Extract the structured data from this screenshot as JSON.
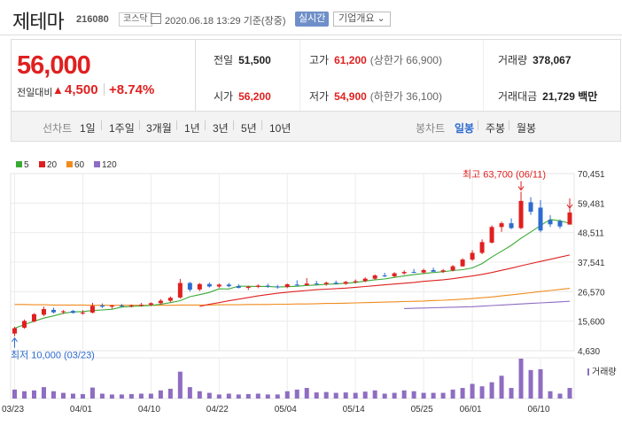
{
  "header": {
    "name": "제테마",
    "code": "216080",
    "market": "코스닥",
    "timestamp": "2020.06.18 13:29 기준(장중)",
    "realtime": "실시간",
    "company_info": "기업개요 ⌄"
  },
  "price": {
    "current": "56,000",
    "change_label": "전일대비",
    "change_arrow": "▲",
    "change_value": "4,500",
    "change_rate": "+8.74%"
  },
  "stats": {
    "prev_close_label": "전일",
    "prev_close": "51,500",
    "high_label": "고가",
    "high": "61,200",
    "upper_limit": "(상한가 66,900)",
    "volume_label": "거래량",
    "volume": "378,067",
    "open_label": "시가",
    "open": "56,200",
    "low_label": "저가",
    "low": "54,900",
    "lower_limit": "(하한가 36,100)",
    "trade_value_label": "거래대금",
    "trade_value": "21,729 백만"
  },
  "periods": {
    "line_label": "선차트",
    "line_items": [
      "1일",
      "1주일",
      "3개월",
      "1년",
      "3년",
      "5년",
      "10년"
    ],
    "candle_label": "봉차트",
    "candle_items": [
      "일봉",
      "주봉",
      "월봉"
    ],
    "active_candle": "일봉"
  },
  "colors": {
    "up": "#e02020",
    "down": "#2d6bd0",
    "ma5": "#3aaa35",
    "ma20": "#e02020",
    "ma60": "#f08c1e",
    "ma120": "#8e6dc2",
    "volume": "#8e6dc2"
  },
  "chart_data": {
    "type": "candlestick",
    "legend": [
      {
        "name": "5",
        "color": "#3aaa35"
      },
      {
        "name": "20",
        "color": "#e02020"
      },
      {
        "name": "60",
        "color": "#f08c1e"
      },
      {
        "name": "120",
        "color": "#8e6dc2"
      }
    ],
    "y_ticks": [
      "70,451",
      "59,481",
      "48,511",
      "37,541",
      "26,570",
      "15,600",
      "4,630"
    ],
    "ylim": [
      4630,
      70451
    ],
    "x_ticks": [
      "03/23",
      "04/01",
      "04/10",
      "04/22",
      "05/04",
      "05/14",
      "05/25",
      "06/01",
      "06/10"
    ],
    "x_tick_index": [
      0,
      7,
      14,
      21,
      28,
      35,
      42,
      47,
      54
    ],
    "high_annotation": "최고 63,700 (06/11)",
    "low_annotation": "최저 10,000 (03/23)",
    "volume_legend": "거래량",
    "candles": [
      [
        11000,
        13500,
        10000,
        13000
      ],
      [
        13200,
        16200,
        12800,
        15700
      ],
      [
        15500,
        18600,
        15200,
        18200
      ],
      [
        18000,
        21000,
        17500,
        20100
      ],
      [
        19800,
        20600,
        18500,
        18900
      ],
      [
        19000,
        19700,
        18300,
        19300
      ],
      [
        19400,
        19800,
        18400,
        18700
      ],
      [
        18700,
        19700,
        18000,
        18800
      ],
      [
        18800,
        22400,
        18500,
        21300
      ],
      [
        21400,
        22200,
        20500,
        21000
      ],
      [
        21000,
        21700,
        20200,
        21400
      ],
      [
        21400,
        22000,
        20800,
        21200
      ],
      [
        21200,
        21800,
        20700,
        21500
      ],
      [
        21500,
        22400,
        21000,
        21700
      ],
      [
        21700,
        22600,
        21200,
        22300
      ],
      [
        22300,
        23800,
        21800,
        23200
      ],
      [
        23200,
        24800,
        22600,
        24300
      ],
      [
        24400,
        31300,
        24000,
        29800
      ],
      [
        29800,
        30200,
        26600,
        27300
      ],
      [
        27400,
        29800,
        26800,
        29400
      ],
      [
        29400,
        30000,
        28100,
        28500
      ],
      [
        28500,
        29600,
        28000,
        29200
      ],
      [
        29200,
        29800,
        28200,
        28600
      ],
      [
        28600,
        29300,
        27800,
        28000
      ],
      [
        28000,
        28800,
        27200,
        28400
      ],
      [
        28400,
        29300,
        27900,
        28800
      ],
      [
        28800,
        29500,
        28000,
        28500
      ],
      [
        28500,
        29100,
        27700,
        28300
      ],
      [
        28300,
        29600,
        27900,
        29300
      ],
      [
        29200,
        30800,
        28700,
        29000
      ],
      [
        29000,
        31600,
        28800,
        29600
      ],
      [
        29600,
        30600,
        29000,
        29400
      ],
      [
        29400,
        30300,
        28800,
        29900
      ],
      [
        29900,
        30700,
        29200,
        29500
      ],
      [
        29500,
        30600,
        29100,
        30200
      ],
      [
        30200,
        31100,
        29600,
        30500
      ],
      [
        30500,
        31900,
        30100,
        31400
      ],
      [
        31400,
        33000,
        31000,
        32600
      ],
      [
        32600,
        33600,
        32000,
        32300
      ],
      [
        32300,
        33800,
        31900,
        33400
      ],
      [
        33400,
        34500,
        32900,
        33900
      ],
      [
        33900,
        35000,
        33500,
        33700
      ],
      [
        33700,
        35100,
        33200,
        34600
      ],
      [
        34600,
        35500,
        34000,
        34000
      ],
      [
        34000,
        35000,
        33500,
        34500
      ],
      [
        34500,
        36500,
        34100,
        36000
      ],
      [
        36000,
        39000,
        35800,
        38500
      ],
      [
        38500,
        42000,
        38000,
        41000
      ],
      [
        41000,
        46000,
        40500,
        45000
      ],
      [
        44800,
        51200,
        44500,
        50600
      ],
      [
        50600,
        52600,
        48800,
        52000
      ],
      [
        52000,
        53800,
        49800,
        50200
      ],
      [
        50200,
        63700,
        49800,
        60300
      ],
      [
        59800,
        61700,
        55100,
        56300
      ],
      [
        57800,
        60600,
        48600,
        49300
      ],
      [
        53200,
        55000,
        50600,
        51600
      ],
      [
        52800,
        53400,
        50000,
        50800
      ],
      [
        51500,
        61200,
        54900,
        56000
      ]
    ],
    "ma5": [
      13000,
      14350,
      15633,
      16750,
      17580,
      18540,
      19040,
      19160,
      19560,
      19780,
      20040,
      20860,
      21080,
      21260,
      21480,
      21860,
      22500,
      23220,
      24700,
      25460,
      26300,
      27640,
      27560,
      28640,
      28540,
      28520,
      28520,
      28300,
      28440,
      28580,
      28900,
      29040,
      29300,
      29460,
      29700,
      30000,
      30540,
      31000,
      31300,
      31880,
      32420,
      32900,
      33320,
      33680,
      34000,
      34420,
      34740,
      35400,
      37000,
      39460,
      41600,
      43800,
      46400,
      48760,
      51120,
      53400,
      52900,
      52000
    ],
    "ma20": [
      null,
      null,
      null,
      null,
      null,
      null,
      null,
      null,
      null,
      null,
      null,
      null,
      null,
      null,
      null,
      null,
      null,
      null,
      null,
      21100,
      21900,
      22500,
      23200,
      23800,
      24400,
      25000,
      25500,
      26000,
      26400,
      26700,
      27000,
      27300,
      27500,
      27700,
      27900,
      28200,
      28500,
      28800,
      29100,
      29400,
      29700,
      30000,
      30400,
      30700,
      31000,
      31400,
      31900,
      32400,
      33000,
      33700,
      34500,
      35300,
      36200,
      37000,
      37800,
      38600,
      39400,
      40200
    ],
    "ma60": [
      21800,
      21800,
      21700,
      21700,
      21600,
      21600,
      21600,
      21600,
      21500,
      21500,
      21500,
      21500,
      21500,
      21500,
      21500,
      21500,
      21500,
      21600,
      21600,
      21600,
      21600,
      21700,
      21700,
      21700,
      21800,
      21800,
      21800,
      21900,
      21900,
      22000,
      22000,
      22100,
      22200,
      22200,
      22300,
      22400,
      22500,
      22600,
      22700,
      22800,
      22900,
      23000,
      23100,
      23300,
      23400,
      23600,
      23800,
      24000,
      24300,
      24600,
      25000,
      25400,
      25800,
      26200,
      26600,
      27000,
      27400,
      27800
    ],
    "ma120": [
      null,
      null,
      null,
      null,
      null,
      null,
      null,
      null,
      null,
      null,
      null,
      null,
      null,
      null,
      null,
      null,
      null,
      null,
      null,
      null,
      null,
      null,
      null,
      null,
      null,
      null,
      null,
      null,
      null,
      null,
      null,
      null,
      null,
      null,
      null,
      null,
      null,
      null,
      null,
      null,
      20300,
      20400,
      20500,
      20600,
      20700,
      20800,
      20900,
      21000,
      21200,
      21400,
      21600,
      21800,
      22000,
      22200,
      22400,
      22600,
      22800,
      23000
    ],
    "volume": [
      0.22,
      0.18,
      0.2,
      0.28,
      0.18,
      0.14,
      0.12,
      0.11,
      0.27,
      0.12,
      0.1,
      0.1,
      0.11,
      0.12,
      0.12,
      0.2,
      0.24,
      0.66,
      0.28,
      0.18,
      0.14,
      0.1,
      0.12,
      0.1,
      0.11,
      0.12,
      0.1,
      0.1,
      0.18,
      0.22,
      0.26,
      0.15,
      0.16,
      0.14,
      0.15,
      0.14,
      0.17,
      0.2,
      0.12,
      0.14,
      0.2,
      0.18,
      0.14,
      0.14,
      0.14,
      0.22,
      0.26,
      0.36,
      0.3,
      0.4,
      0.56,
      0.26,
      0.98,
      0.7,
      0.72,
      0.18,
      0.12,
      0.26
    ]
  }
}
